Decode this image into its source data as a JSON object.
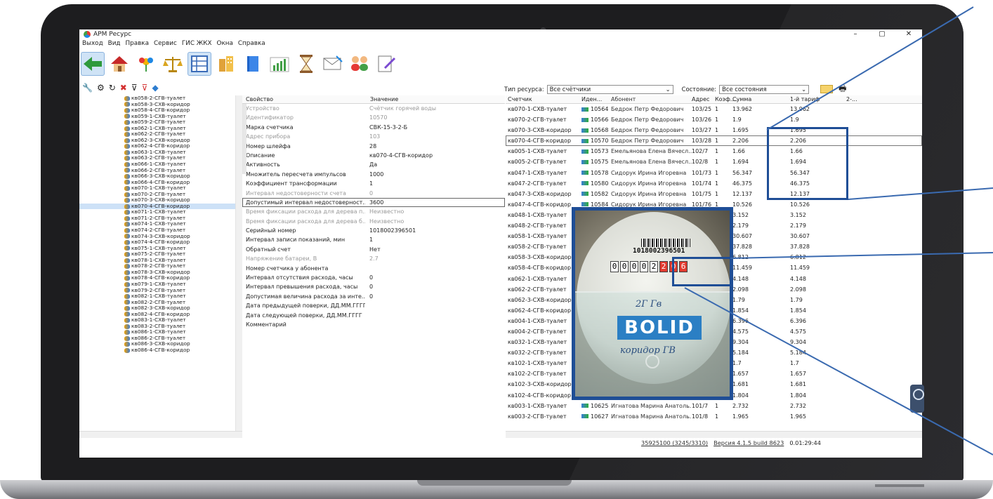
{
  "window": {
    "title": "АРМ Ресурс",
    "min": "–",
    "max": "▢",
    "close": "✕"
  },
  "menu": [
    "Выход",
    "Вид",
    "Правка",
    "Сервис",
    "ГИС ЖКХ",
    "Окна",
    "Справка"
  ],
  "toolbar_icons": [
    "back-arrow-icon",
    "house-icon",
    "flower-icon",
    "scales-icon",
    "table-icon",
    "building-icon",
    "book-icon",
    "chart-icon",
    "hourglass-icon",
    "mail-icon",
    "users-icon",
    "report-edit-icon"
  ],
  "toolbar2_icons": [
    "wrench-icon",
    "gears-icon",
    "refresh-icon",
    "delete-icon",
    "filter-icon",
    "filter-clear-icon",
    "plugin-icon"
  ],
  "filters": {
    "resource_label": "Тип ресурса:",
    "resource_value": "Все счётчики",
    "state_label": "Состояние:",
    "state_value": "Все состояния"
  },
  "tree": [
    "кв058-2-СГВ-туалет",
    "кв058-3-СХВ-коридор",
    "кв058-4-СГВ-коридор",
    "кв059-1-СХВ-туалет",
    "кв059-2-СГВ-туалет",
    "кв062-1-СХВ-туалет",
    "кв062-2-СГВ-туалет",
    "кв062-3-СХВ-коридор",
    "кв062-4-СГВ-коридор",
    "кв063-1-СХВ-туалет",
    "кв063-2-СГВ-туалет",
    "кв066-1-СХВ-туалет",
    "кв066-2-СГВ-туалет",
    "кв066-3-СХВ-коридор",
    "кв066-4-СГВ-коридор",
    "кв070-1-СХВ-туалет",
    "кв070-2-СГВ-туалет",
    "кв070-3-СХВ-коридор",
    "кв070-4-СГВ-коридор",
    "кв071-1-СХВ-туалет",
    "кв071-2-СГВ-туалет",
    "кв074-1-СХВ-туалет",
    "кв074-2-СГВ-туалет",
    "кв074-3-СХВ-коридор",
    "кв074-4-СГВ-коридор",
    "кв075-1-СХВ-туалет",
    "кв075-2-СГВ-туалет",
    "кв078-1-СХВ-туалет",
    "кв078-2-СГВ-туалет",
    "кв078-3-СХВ-коридор",
    "кв078-4-СГВ-коридор",
    "кв079-1-СХВ-туалет",
    "кв079-2-СГВ-туалет",
    "кв082-1-СХВ-туалет",
    "кв082-2-СГВ-туалет",
    "кв082-3-СХВ-коридор",
    "кв082-4-СГВ-коридор",
    "кв083-1-СХВ-туалет",
    "кв083-2-СГВ-туалет",
    "кв086-1-СХВ-туалет",
    "кв086-2-СГВ-туалет",
    "кв086-3-СХВ-коридор",
    "кв086-4-СГВ-коридор"
  ],
  "tree_selected": "кв070-4-СГВ-коридор",
  "props": {
    "col_property": "Свойство",
    "col_value": "Значение",
    "rows": [
      {
        "k": "Устройство",
        "v": "Счётчик горячей воды",
        "gray": true
      },
      {
        "k": "Идентификатор",
        "v": "10570",
        "gray": true
      },
      {
        "k": "Марка счетчика",
        "v": "СВК-15-3-2-Б"
      },
      {
        "k": "Адрес прибора",
        "v": "103",
        "gray": true
      },
      {
        "k": "Номер шлейфа",
        "v": "28"
      },
      {
        "k": "Описание",
        "v": "кв070-4-СГВ-коридор"
      },
      {
        "k": "Активность",
        "v": "Да"
      },
      {
        "k": "Множитель пересчета импульсов",
        "v": "1000"
      },
      {
        "k": "Коэффициент трансформации",
        "v": "1"
      },
      {
        "k": "Интервал недостоверности счета",
        "v": "0",
        "gray": true
      },
      {
        "k": "Допустимый интервал недостоверност...",
        "v": "3600",
        "edit": true
      },
      {
        "k": "Время фиксации расхода для дерева п...",
        "v": "Неизвестно",
        "gray": true
      },
      {
        "k": "Время фиксации расхода для дерева б...",
        "v": "Неизвестно",
        "gray": true
      },
      {
        "k": "Серийный номер",
        "v": "1018002396501"
      },
      {
        "k": "Интервал записи показаний, мин",
        "v": "1"
      },
      {
        "k": "Обратный счет",
        "v": "Нет"
      },
      {
        "k": "Напряжение батареи, В",
        "v": "2.7",
        "gray": true
      },
      {
        "k": "Номер счетчика у абонента",
        "v": ""
      },
      {
        "k": "Интервал отсутствия расхода, часы",
        "v": "0"
      },
      {
        "k": "Интервал превышения расхода, часы",
        "v": "0"
      },
      {
        "k": "Допустимая величина расхода за инте...",
        "v": "0"
      },
      {
        "k": "Дата предыдущей поверки, ДД.ММ.ГГГГ",
        "v": ""
      },
      {
        "k": "Дата следующей поверки, ДД.ММ.ГГГГ",
        "v": ""
      },
      {
        "k": "Комментарий",
        "v": ""
      }
    ]
  },
  "grid": {
    "headers": [
      "Счетчик",
      "Иден...",
      "Абонент",
      "Адрес",
      "Коэф....",
      "Сумма",
      "1-й тариф",
      "2-..."
    ],
    "rows": [
      {
        "c": "кв070-1-СХВ-туалет",
        "id": "10564",
        "ab": "Бедрок Петр Федорович",
        "addr": "103/25",
        "k": "1",
        "sum": "13.962",
        "t1": "13.962"
      },
      {
        "c": "кв070-2-СГВ-туалет",
        "id": "10566",
        "ab": "Бедрок Петр Федорович",
        "addr": "103/26",
        "k": "1",
        "sum": "1.9",
        "t1": "1.9"
      },
      {
        "c": "кв070-3-СХВ-коридор",
        "id": "10568",
        "ab": "Бедрок Петр Федорович",
        "addr": "103/27",
        "k": "1",
        "sum": "1.695",
        "t1": "1.695"
      },
      {
        "c": "кв070-4-СГВ-коридор",
        "id": "10570",
        "ab": "Бедрок Петр Федорович",
        "addr": "103/28",
        "k": "1",
        "sum": "2.206",
        "t1": "2.206",
        "sel": true
      },
      {
        "c": "кв005-1-СХВ-туалет",
        "id": "10573",
        "ab": "Емельянова Елена Вячесл...",
        "addr": "102/7",
        "k": "1",
        "sum": "1.66",
        "t1": "1.66"
      },
      {
        "c": "кв005-2-СГВ-туалет",
        "id": "10575",
        "ab": "Емельянова Елена Вячесл...",
        "addr": "102/8",
        "k": "1",
        "sum": "1.694",
        "t1": "1.694"
      },
      {
        "c": "кв047-1-СХВ-туалет",
        "id": "10578",
        "ab": "Сидорук Ирина Игоревна",
        "addr": "101/73",
        "k": "1",
        "sum": "56.347",
        "t1": "56.347"
      },
      {
        "c": "кв047-2-СГВ-туалет",
        "id": "10580",
        "ab": "Сидорук Ирина Игоревна",
        "addr": "101/74",
        "k": "1",
        "sum": "46.375",
        "t1": "46.375"
      },
      {
        "c": "кв047-3-СХВ-коридор",
        "id": "10582",
        "ab": "Сидорук Ирина Игоревна",
        "addr": "101/75",
        "k": "1",
        "sum": "12.137",
        "t1": "12.137"
      },
      {
        "c": "кв047-4-СГВ-коридор",
        "id": "10584",
        "ab": "Сидорук Ирина Игоревна",
        "addr": "101/76",
        "k": "1",
        "sum": "10.526",
        "t1": "10.526"
      },
      {
        "c": "кв048-1-СХВ-туалет",
        "id": "",
        "ab": "",
        "addr": "",
        "k": "",
        "sum": "3.152",
        "t1": "3.152"
      },
      {
        "c": "кв048-2-СГВ-туалет",
        "id": "",
        "ab": "",
        "addr": "",
        "k": "",
        "sum": "2.179",
        "t1": "2.179"
      },
      {
        "c": "кв058-1-СХВ-туалет",
        "id": "",
        "ab": "",
        "addr": "",
        "k": "",
        "sum": "30.607",
        "t1": "30.607"
      },
      {
        "c": "кв058-2-СГВ-туалет",
        "id": "",
        "ab": "",
        "addr": "",
        "k": "",
        "sum": "37.828",
        "t1": "37.828"
      },
      {
        "c": "кв058-3-СХВ-коридор",
        "id": "",
        "ab": "",
        "addr": "",
        "k": "",
        "sum": "6.812",
        "t1": "6.812"
      },
      {
        "c": "кв058-4-СГВ-коридор",
        "id": "",
        "ab": "",
        "addr": "",
        "k": "",
        "sum": "11.459",
        "t1": "11.459"
      },
      {
        "c": "кв062-1-СХВ-туалет",
        "id": "",
        "ab": "",
        "addr": "",
        "k": "",
        "sum": "4.148",
        "t1": "4.148"
      },
      {
        "c": "кв062-2-СГВ-туалет",
        "id": "",
        "ab": "",
        "addr": "",
        "k": "",
        "sum": "2.098",
        "t1": "2.098"
      },
      {
        "c": "кв062-3-СХВ-коридор",
        "id": "",
        "ab": "",
        "addr": "",
        "k": "",
        "sum": "1.79",
        "t1": "1.79"
      },
      {
        "c": "кв062-4-СГВ-коридор",
        "id": "",
        "ab": "",
        "addr": "",
        "k": "",
        "sum": "1.854",
        "t1": "1.854"
      },
      {
        "c": "кв004-1-СХВ-туалет",
        "id": "",
        "ab": "",
        "addr": "",
        "k": "",
        "sum": "6.396",
        "t1": "6.396"
      },
      {
        "c": "кв004-2-СГВ-туалет",
        "id": "",
        "ab": "",
        "addr": "",
        "k": "",
        "sum": "4.575",
        "t1": "4.575"
      },
      {
        "c": "кв032-1-СХВ-туалет",
        "id": "",
        "ab": "",
        "addr": "",
        "k": "",
        "sum": "9.304",
        "t1": "9.304"
      },
      {
        "c": "кв032-2-СГВ-туалет",
        "id": "",
        "ab": "",
        "addr": "",
        "k": "",
        "sum": "5.184",
        "t1": "5.184"
      },
      {
        "c": "кв102-1-СХВ-туалет",
        "id": "",
        "ab": "",
        "addr": "",
        "k": "",
        "sum": "1.7",
        "t1": "1.7"
      },
      {
        "c": "кв102-2-СГВ-туалет",
        "id": "",
        "ab": "",
        "addr": "",
        "k": "",
        "sum": "1.657",
        "t1": "1.657"
      },
      {
        "c": "кв102-3-СХВ-коридор",
        "id": "",
        "ab": "",
        "addr": "",
        "k": "",
        "sum": "1.681",
        "t1": "1.681"
      },
      {
        "c": "кв102-4-СГВ-коридор",
        "id": "",
        "ab": "",
        "addr": "",
        "k": "",
        "sum": "1.804",
        "t1": "1.804"
      },
      {
        "c": "кв003-1-СХВ-туалет",
        "id": "10625",
        "ab": "Игнатова Марина Анатоль...",
        "addr": "101/7",
        "k": "1",
        "sum": "2.732",
        "t1": "2.732"
      },
      {
        "c": "кв003-2-СГВ-туалет",
        "id": "10627",
        "ab": "Игнатова Марина Анатоль...",
        "addr": "101/8",
        "k": "1",
        "sum": "1.965",
        "t1": "1.965"
      }
    ]
  },
  "status": {
    "counter": "35925100 (3245/3310)",
    "version": "Версия 4.1.5 build 8623",
    "time": "0.01:29:44"
  },
  "photo": {
    "serial": "1018002396501",
    "digits": [
      "0",
      "0",
      "0",
      "0",
      "2",
      "2",
      "0",
      "6"
    ],
    "brand": "BOLID",
    "hand1": "2Г Гв",
    "hand2": "коридор ГВ"
  },
  "colors": {
    "accent": "#1f4e96",
    "selection": "#cde1f7"
  }
}
